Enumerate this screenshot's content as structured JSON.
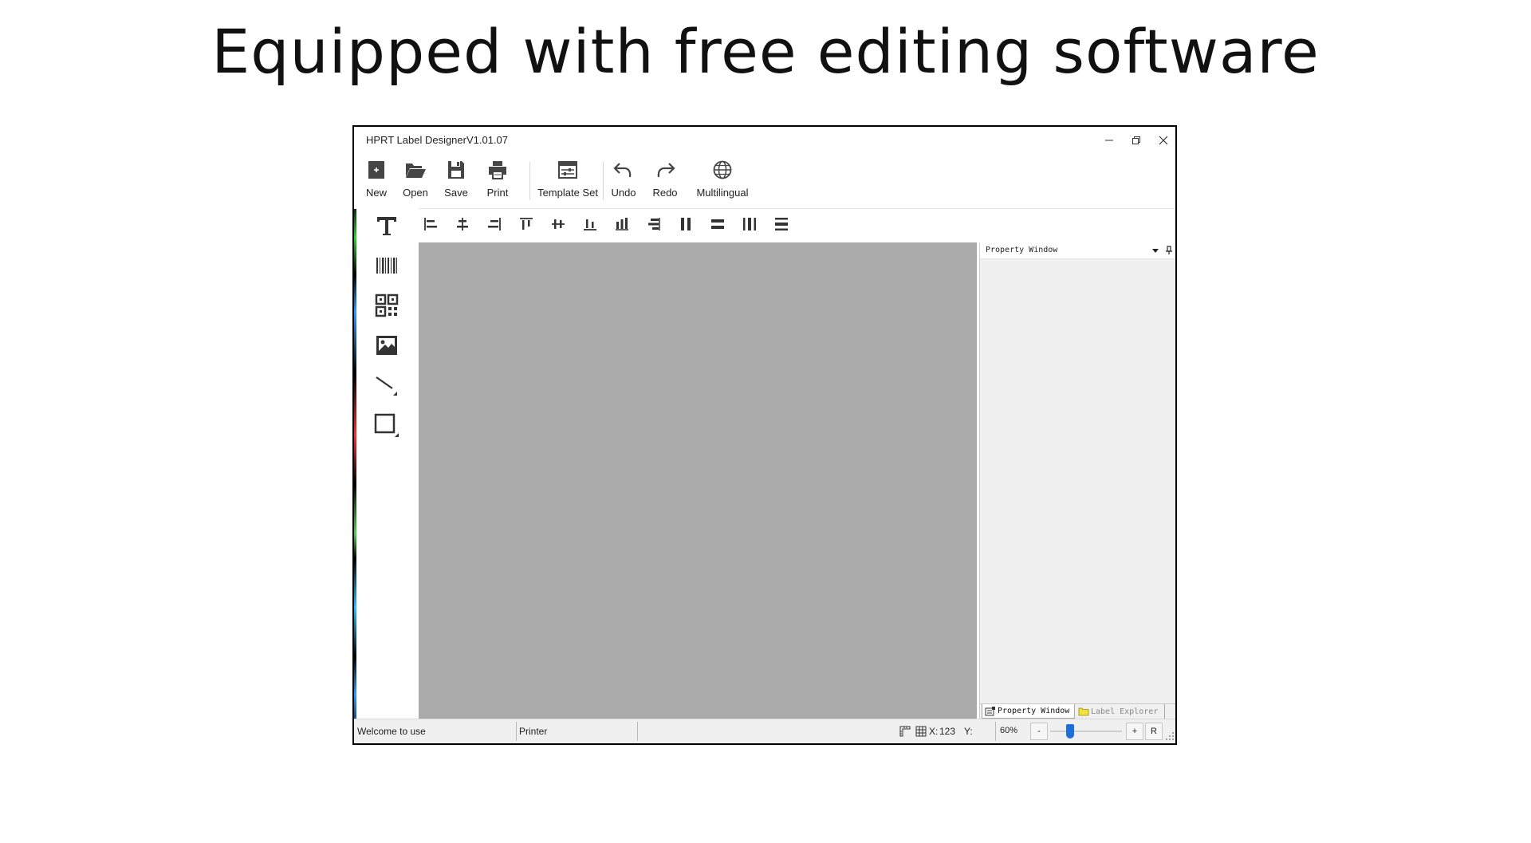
{
  "slide": {
    "title": "Equipped with free editing software"
  },
  "window": {
    "title": "HPRT Label DesignerV1.01.07",
    "controls": [
      "minimize-icon",
      "restore-icon",
      "close-icon"
    ]
  },
  "toolbar": {
    "items": [
      {
        "label": "New",
        "icon": "new-file-icon"
      },
      {
        "label": "Open",
        "icon": "folder-open-icon"
      },
      {
        "label": "Save",
        "icon": "save-icon"
      },
      {
        "label": "Print",
        "icon": "printer-icon"
      },
      {
        "label": "Template Set",
        "icon": "template-set-icon"
      },
      {
        "label": "Undo",
        "icon": "undo-icon"
      },
      {
        "label": "Redo",
        "icon": "redo-icon"
      },
      {
        "label": "Multilingual",
        "icon": "globe-icon"
      }
    ]
  },
  "align_toolbar": {
    "icons": [
      "align-left-icon",
      "align-center-horizontal-icon",
      "align-right-icon",
      "align-top-icon",
      "align-middle-vertical-icon",
      "align-bottom-icon",
      "same-height-icon",
      "same-width-icon",
      "distribute-horizontal-icon",
      "distribute-vertical-icon",
      "space-horizontal-icon",
      "space-vertical-icon"
    ]
  },
  "left_tools": {
    "icons": [
      "text-icon",
      "barcode-icon",
      "qrcode-icon",
      "image-icon",
      "line-icon",
      "rectangle-icon"
    ]
  },
  "property_window": {
    "title": "Property Window",
    "tabs": [
      {
        "label": "Property Window",
        "active": true
      },
      {
        "label": "Label Explorer",
        "active": false
      }
    ]
  },
  "status_bar": {
    "welcome": "Welcome to use",
    "printer": "Printer",
    "x_label": "X:",
    "x_value": "123",
    "y_label": "Y:",
    "zoom": "60%",
    "zoom_minus": "-",
    "zoom_plus": "+",
    "zoom_reset": "R"
  },
  "colors": {
    "canvas": "#aaaaaa",
    "panel": "#f0f0f0",
    "accent": "#1e6fd9"
  }
}
